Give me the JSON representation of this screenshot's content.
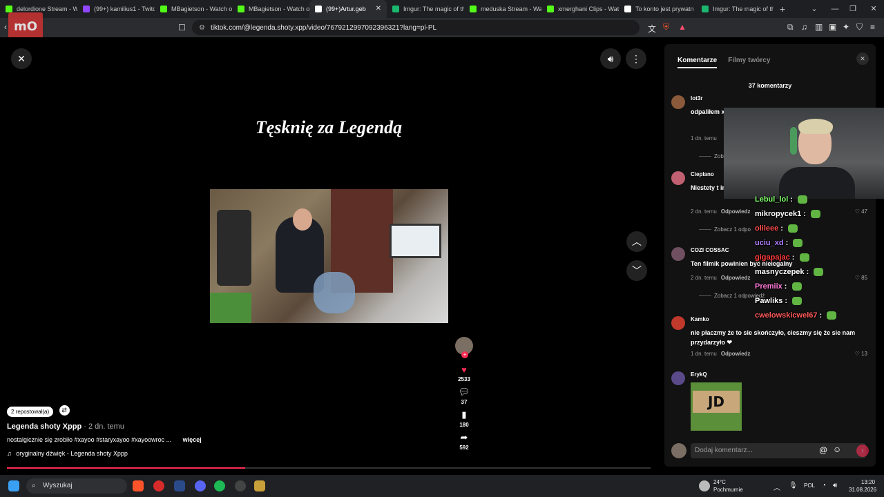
{
  "browser": {
    "tabs": [
      {
        "label": "delordione Stream - W",
        "color": "#53fc18"
      },
      {
        "label": "(99+) kamilius1 - Twitc",
        "color": "#9146ff"
      },
      {
        "label": "MBagietson - Watch o",
        "color": "#53fc18"
      },
      {
        "label": "MBagietson - Watch o",
        "color": "#53fc18"
      },
      {
        "label": "(99+)Artur.geb",
        "color": "#ffffff",
        "active": true
      },
      {
        "label": "Imgur: The magic of th",
        "color": "#1bb76e"
      },
      {
        "label": "meduska Stream - Wa",
        "color": "#53fc18"
      },
      {
        "label": "xmerghani Clips - Wat",
        "color": "#53fc18"
      },
      {
        "label": "To konto jest prywatn",
        "color": "#ffffff"
      },
      {
        "label": "Imgur: The magic of th",
        "color": "#1bb76e"
      }
    ],
    "url": "tiktok.com/@legenda.shoty.xpp/video/7679212997092396321?lang=pl-PL"
  },
  "video": {
    "overlay_title": "Tęsknię za Legendą",
    "reposts": "2 repostował(a)",
    "author": "Legenda shoty Xppp",
    "posted": "· 2 dn. temu",
    "description": "nostalgicznie się zrobiło #xayoo #staryxayoo #xayoowroc ...",
    "more": "więcej",
    "sound": "oryginalny dźwięk - Legenda shoty Xppp",
    "likes": "2533",
    "comments": "37",
    "saves": "180",
    "shares": "592",
    "progress": 0.37
  },
  "panel": {
    "tab_comments": "Komentarze",
    "tab_creator": "Filmy twórcy",
    "count": "37 komentarzy",
    "comments": [
      {
        "user": "lot3r",
        "text": "odpaliłem xayoo...",
        "time": "1 dn. temu",
        "reply": "",
        "likes": "",
        "more": "Zoba",
        "avatar": "#8a5a3a"
      },
      {
        "user": "Cieplano",
        "text": "Niestety t internetu",
        "time": "2 dn. temu",
        "reply": "Odpowiedz",
        "likes": "47",
        "more": "Zobacz 1 odpo",
        "avatar": "#c06070"
      },
      {
        "user": "COZI COSSAC",
        "text": "Ten filmik powinien być nielegalny",
        "time": "2 dn. temu",
        "reply": "Odpowiedz",
        "likes": "85",
        "more": "Zobacz 1 odpowiedź",
        "avatar": "#705060"
      },
      {
        "user": "Kamko",
        "text": "nie płaczmy że to sie skończyło, cieszmy się że sie nam przydarzyło ❤",
        "time": "1 dn. temu",
        "reply": "Odpowiedz",
        "likes": "13",
        "more": "",
        "avatar": "#c0392b"
      },
      {
        "user": "ErykQ",
        "text": "",
        "time": "",
        "reply": "",
        "likes": "",
        "more": "",
        "avatar": "#5a4a8a"
      }
    ],
    "jd_text": "JD",
    "input_placeholder": "Dodaj komentarz..."
  },
  "chat": [
    {
      "user": "Lebul_lol",
      "color": "#7fff6a"
    },
    {
      "user": "mikropycek1",
      "color": "#ffffff"
    },
    {
      "user": "olileee",
      "color": "#ff4d4d"
    },
    {
      "user": "uciu_xd",
      "color": "#b07cff"
    },
    {
      "user": "gigapajac",
      "color": "#ff3b3b"
    },
    {
      "user": "masnyczepek",
      "color": "#ffffff"
    },
    {
      "user": "Premiix",
      "color": "#ff7ad9"
    },
    {
      "user": "Pawliks",
      "color": "#ffffff"
    },
    {
      "user": "cwelowskicwel67",
      "color": "#ff5a5a"
    }
  ],
  "taskbar": {
    "search": "Wyszukaj",
    "weather_temp": "24°C",
    "weather_desc": "Pochmurnie",
    "lang": "POL",
    "time": "13:20",
    "date": "31.08.2026"
  }
}
